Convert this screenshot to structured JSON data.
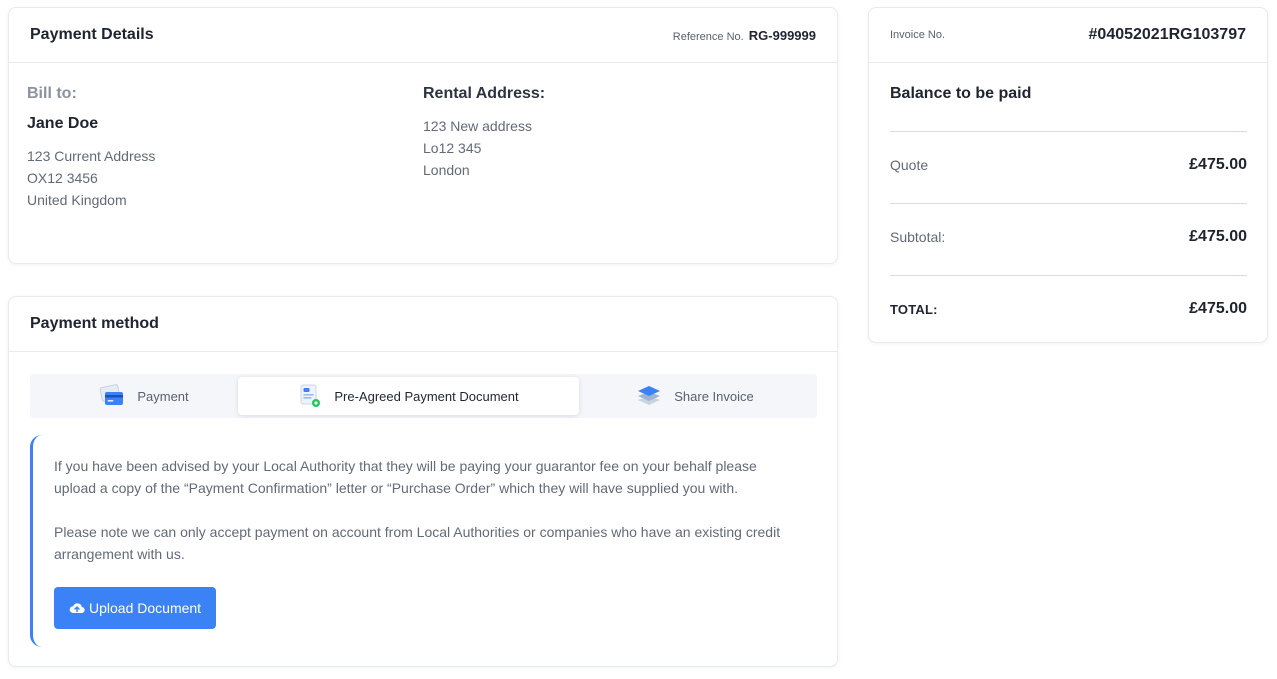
{
  "payment_details": {
    "title": "Payment Details",
    "reference_label": "Reference No.",
    "reference_value": "RG-999999",
    "bill_to": {
      "heading": "Bill to:",
      "name": "Jane Doe",
      "address_lines": [
        "123 Current Address",
        "OX12 3456",
        "United Kingdom"
      ]
    },
    "rental": {
      "heading": "Rental Address:",
      "address_lines": [
        "123 New address",
        "Lo12 345",
        "London"
      ]
    }
  },
  "payment_method": {
    "title": "Payment method",
    "tabs": [
      {
        "label": "Payment",
        "icon": "credit-card-icon",
        "active": false
      },
      {
        "label": "Pre-Agreed Payment Document",
        "icon": "document-icon",
        "active": true
      },
      {
        "label": "Share Invoice",
        "icon": "layers-icon",
        "active": false
      }
    ],
    "info_paragraphs": [
      "If you have been advised by your Local Authority that they will be paying your guarantor fee on your behalf please upload a copy of the “Payment Confirmation” letter or “Purchase Order” which they will have supplied you with.",
      "Please note we can only accept payment on account from Local Authorities or companies who have an existing credit arrangement with us."
    ],
    "upload_button": {
      "label": "Upload Document",
      "icon": "cloud-upload-icon"
    }
  },
  "summary": {
    "invoice_label": "Invoice No.",
    "invoice_value": "#04052021RG103797",
    "balance_heading": "Balance to be paid",
    "rows": [
      {
        "label": "Quote",
        "value": "£475.00"
      },
      {
        "label": "Subtotal:",
        "value": "£475.00"
      },
      {
        "label": "TOTAL:",
        "value": "£475.00"
      }
    ]
  },
  "colors": {
    "accent": "#3b82f6",
    "tab_bg": "#f4f6f9",
    "border": "#e7eaee"
  }
}
